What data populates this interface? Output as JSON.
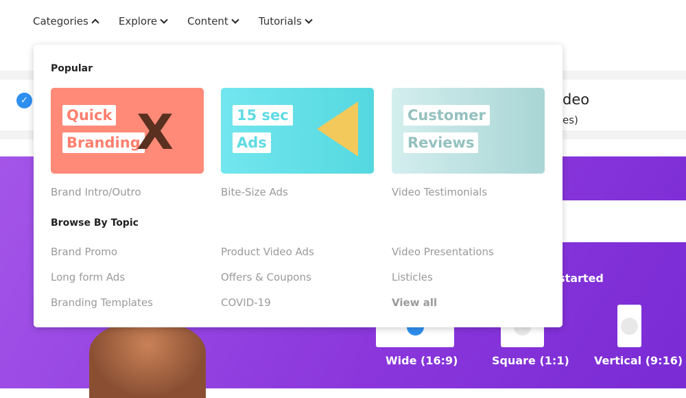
{
  "nav": [
    {
      "label": "Categories",
      "open": true
    },
    {
      "label": "Explore"
    },
    {
      "label": "Content"
    },
    {
      "label": "Tutorials"
    }
  ],
  "background": {
    "video_title": "deo",
    "video_sub": "es)",
    "get_started": "et started",
    "ratios": [
      "Wide (16:9)",
      "Square (1:1)",
      "Vertical (9:16)"
    ]
  },
  "dropdown": {
    "popular_heading": "Popular",
    "cards": [
      {
        "tag1": "Quick",
        "tag2": "Branding",
        "label": "Brand Intro/Outro",
        "color": "#ff8a78"
      },
      {
        "tag1": "15 sec",
        "tag2": "Ads",
        "label": "Bite-Size Ads",
        "color": "#6ee3ea"
      },
      {
        "tag1": "Customer",
        "tag2": "Reviews",
        "label": "Video Testimonials",
        "color": "#c9e8e8"
      }
    ],
    "topic_heading": "Browse By Topic",
    "topics": [
      [
        "Brand Promo",
        "Long form Ads",
        "Branding Templates"
      ],
      [
        "Product Video Ads",
        "Offers & Coupons",
        "COVID-19"
      ],
      [
        "Video Presentations",
        "Listicles",
        "View all"
      ]
    ]
  }
}
